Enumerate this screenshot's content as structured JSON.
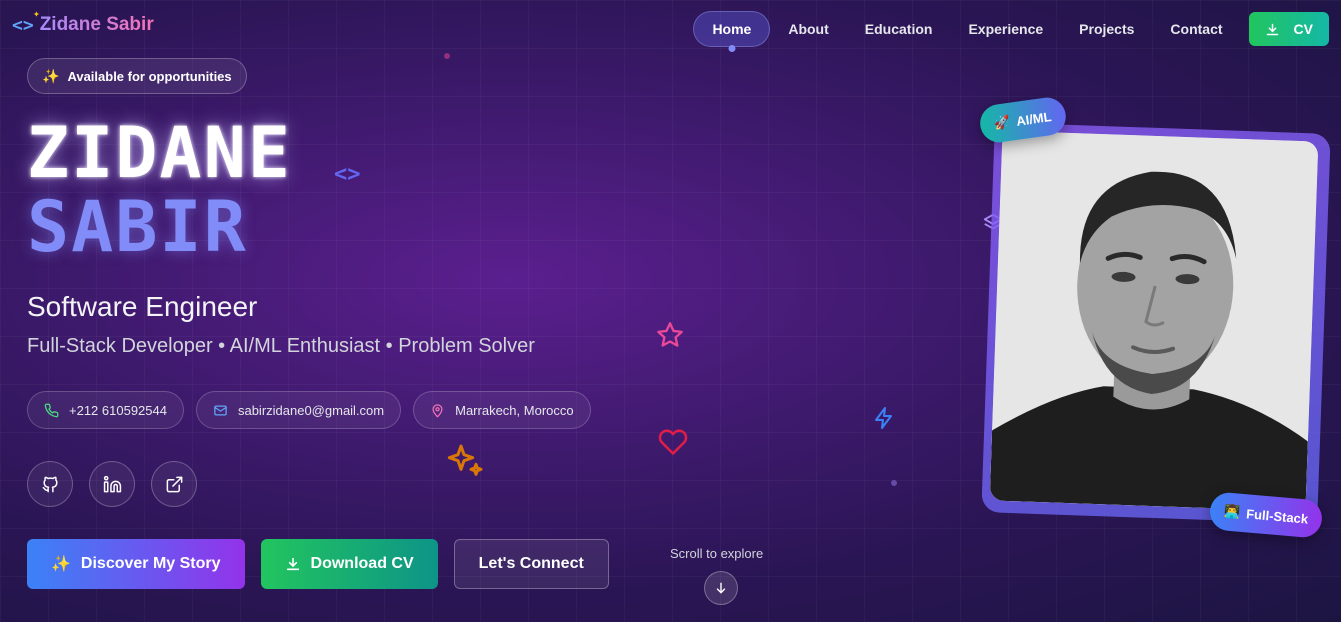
{
  "logo": {
    "icon": "code-brackets-icon",
    "name": "Zidane Sabir"
  },
  "nav": {
    "items": [
      "Home",
      "About",
      "Education",
      "Experience",
      "Projects",
      "Contact"
    ],
    "active": "Home",
    "cv_label": "CV"
  },
  "hero": {
    "badge": "Available for opportunities",
    "first_name": "ZIDANE",
    "last_name": "SABIR",
    "role": "Software Engineer",
    "tagline": "Full-Stack Developer • AI/ML Enthusiast • Problem Solver"
  },
  "contacts": {
    "phone": "+212 610592544",
    "email": "sabirzidane0@gmail.com",
    "location": "Marrakech, Morocco"
  },
  "socials": [
    "github-icon",
    "linkedin-icon",
    "external-link-icon"
  ],
  "ctas": {
    "discover": "Discover My Story",
    "download": "Download CV",
    "connect": "Let's Connect"
  },
  "scroll": {
    "label": "Scroll to explore"
  },
  "photo_tags": {
    "aiml": "AI/ML",
    "fullstack": "Full-Stack"
  },
  "colors": {
    "accent": "#818cf8",
    "green": "#22c55e",
    "purple": "#9333ea"
  }
}
